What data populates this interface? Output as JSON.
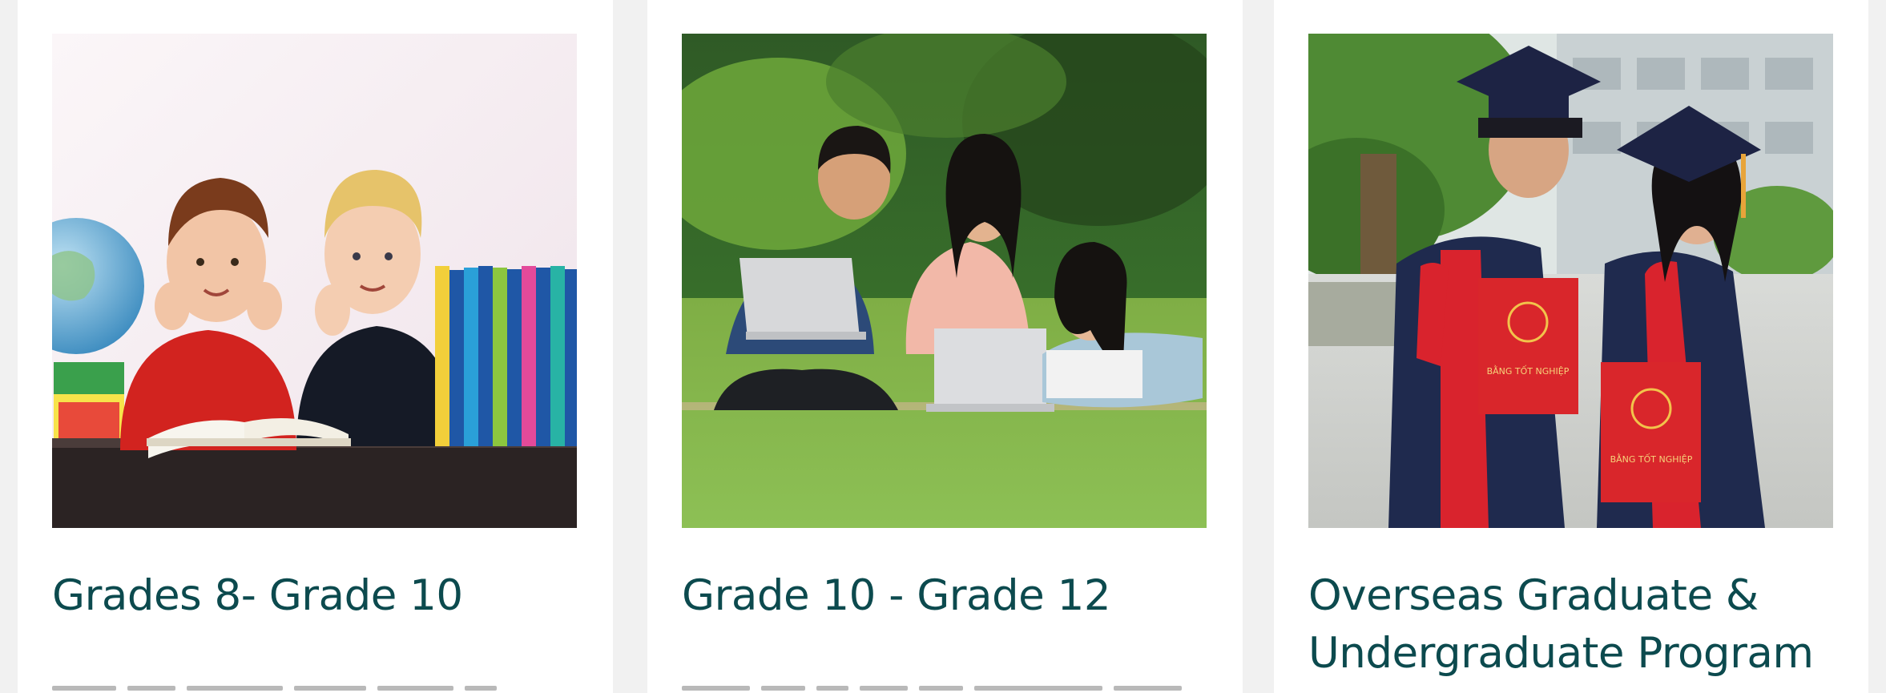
{
  "cards": [
    {
      "title": "Grades 8- Grade 10",
      "image_alt": "Two smiling boys at a desk with books and a globe"
    },
    {
      "title": "Grade 10 - Grade 12",
      "image_alt": "Three students studying on laptops on the grass"
    },
    {
      "title": "Overseas Graduate & Undergraduate Program",
      "image_alt": "Two graduates in caps and gowns holding red diplomas"
    }
  ],
  "diploma_text": "BẰNG TỐT NGHIỆP",
  "colors": {
    "title": "#0c4a4e",
    "page_background": "#f1f1f1",
    "card_background": "#ffffff"
  }
}
